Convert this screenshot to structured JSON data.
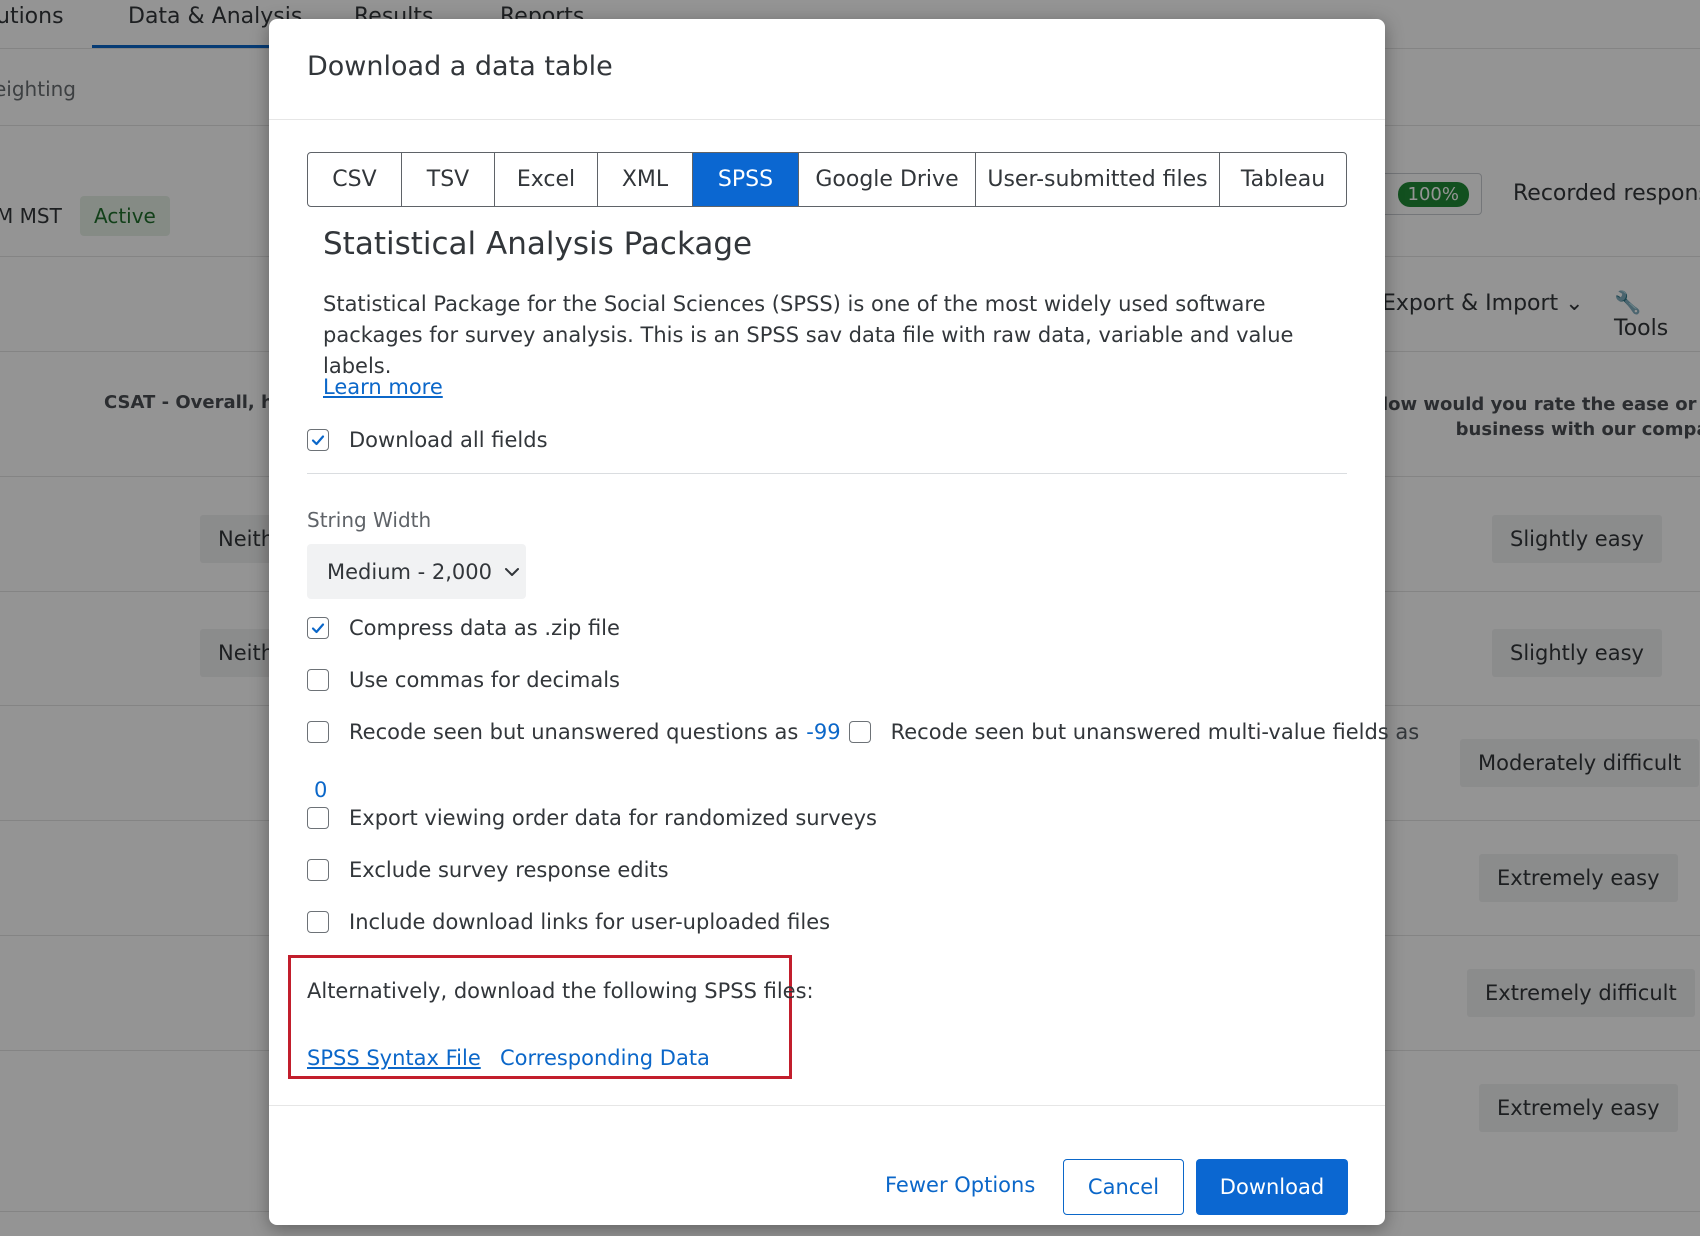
{
  "background": {
    "top_tabs": [
      "utions",
      "Data & Analysis",
      "Results",
      "Reports"
    ],
    "subnav_text": "eighting",
    "status_time": "M MST",
    "status_badge": "Active",
    "progress_badge": "100%",
    "recorded_label": "Recorded response",
    "export_label": "Export & Import",
    "tools_label": "Tools",
    "col_left_header": "CSAT - Overall, ho",
    "col_right_header_line1": "low would you rate the ease or diffi",
    "col_right_header_line2": "business with our compan...",
    "rows": [
      {
        "left": "Neith",
        "right": "Slightly easy"
      },
      {
        "left": "Neith",
        "right": "Slightly easy"
      },
      {
        "left": "",
        "right": "Moderately difficult"
      },
      {
        "left": "",
        "right": "Extremely easy"
      },
      {
        "left": "",
        "right": "Extremely difficult"
      },
      {
        "left": "",
        "right": "Extremely easy"
      }
    ]
  },
  "modal": {
    "title": "Download a data table",
    "tabs": [
      "CSV",
      "TSV",
      "Excel",
      "XML",
      "SPSS",
      "Google Drive",
      "User-submitted files",
      "Tableau"
    ],
    "selected_tab": "SPSS",
    "section_title": "Statistical Analysis Package",
    "description": "Statistical Package for the Social Sciences (SPSS) is one of the most widely used software packages for survey analysis. This is an SPSS sav data file with raw data, variable and value labels.",
    "learn_more": "Learn more",
    "download_all_fields": {
      "label": "Download all fields",
      "checked": true
    },
    "string_width": {
      "label": "String Width",
      "value": "Medium - 2,000"
    },
    "options": {
      "compress": {
        "label": "Compress data as .zip file",
        "checked": true
      },
      "commas": {
        "label": "Use commas for decimals",
        "checked": false
      },
      "recode_questions": {
        "label": "Recode seen but unanswered questions as",
        "value": "-99",
        "checked": false
      },
      "recode_multi": {
        "label": "Recode seen but unanswered multi-value fields as",
        "value": "0",
        "checked": false
      },
      "viewing_order": {
        "label": "Export viewing order data for randomized surveys",
        "checked": false
      },
      "exclude_edits": {
        "label": "Exclude survey response edits",
        "checked": false
      },
      "download_links": {
        "label": "Include download links for user-uploaded files",
        "checked": false
      }
    },
    "alternative": {
      "text": "Alternatively, download the following SPSS files:",
      "syntax_link": "SPSS Syntax File",
      "data_link": "Corresponding Data"
    },
    "footer": {
      "fewer_options": "Fewer Options",
      "cancel": "Cancel",
      "download": "Download"
    }
  },
  "colors": {
    "accent": "#0b67d1",
    "link": "#0b67c9",
    "highlight_box": "#c21e2c",
    "success": "#1f8a36"
  }
}
